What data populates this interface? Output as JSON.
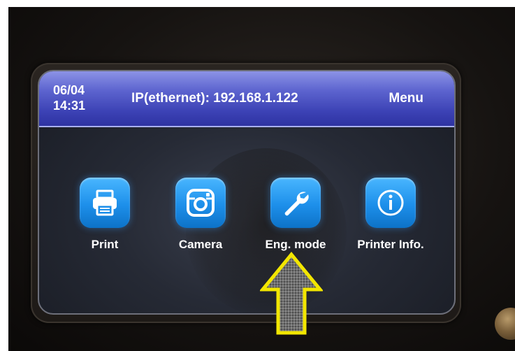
{
  "header": {
    "date": "06/04",
    "time": "14:31",
    "ip_text": "IP(ethernet): 192.168.1.122",
    "menu_label": "Menu"
  },
  "tiles": [
    {
      "label": "Print",
      "icon": "printer-icon"
    },
    {
      "label": "Camera",
      "icon": "camera-icon"
    },
    {
      "label": "Eng. mode",
      "icon": "wrench-icon"
    },
    {
      "label": "Printer Info.",
      "icon": "info-icon"
    }
  ],
  "colors": {
    "header_blue": "#3b41b4",
    "tile_blue": "#1d8fea",
    "arrow_yellow": "#f2e600"
  }
}
